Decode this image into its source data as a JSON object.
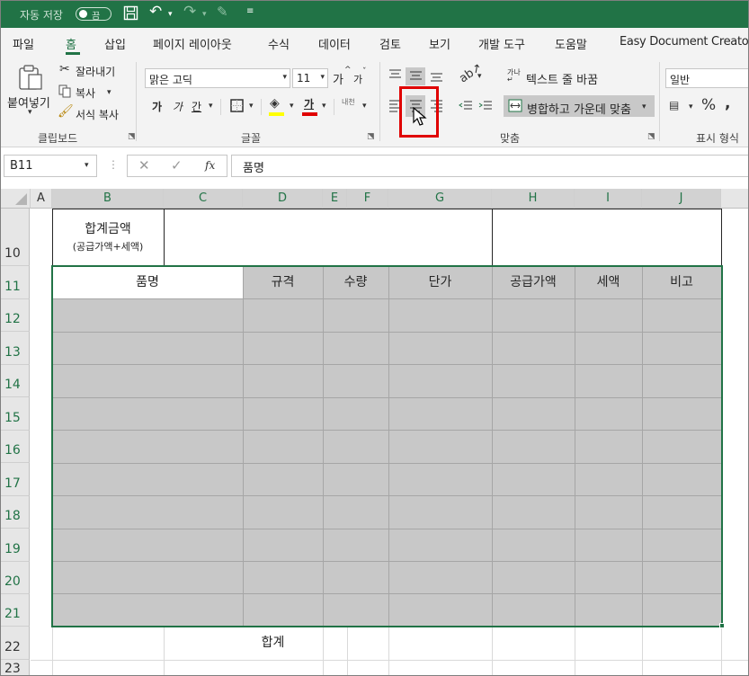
{
  "titlebar": {
    "autosave_label": "자동 저장",
    "autosave_state": "끔"
  },
  "tabs": [
    "파일",
    "홈",
    "삽입",
    "페이지 레이아웃",
    "수식",
    "데이터",
    "검토",
    "보기",
    "개발 도구",
    "도움말",
    "Easy Document Creator"
  ],
  "active_tab": "홈",
  "ribbon": {
    "clipboard": {
      "paste": "붙여넣기",
      "cut": "잘라내기",
      "copy": "복사",
      "format_painter": "서식 복사",
      "group_label": "클립보드"
    },
    "font": {
      "font_name": "맑은 고딕",
      "font_size": "11",
      "grow": "가",
      "shrink": "가",
      "bold": "가",
      "italic": "가",
      "underline": "간",
      "font_color": "가",
      "phonetic": "내천",
      "group_label": "글꼴"
    },
    "alignment": {
      "wrap_text": "텍스트 줄 바꿈",
      "merge_center": "병합하고 가운데 맞춤",
      "group_label": "맞춤"
    },
    "number": {
      "format": "일반",
      "group_label": "표시 형식"
    }
  },
  "formula_bar": {
    "name_box": "B11",
    "fx": "fx",
    "content": "품명"
  },
  "columns": [
    "A",
    "B",
    "C",
    "D",
    "E",
    "F",
    "G",
    "H",
    "I",
    "J"
  ],
  "rows": [
    "10",
    "11",
    "12",
    "13",
    "14",
    "15",
    "16",
    "17",
    "18",
    "19",
    "20",
    "21",
    "22",
    "23"
  ],
  "sheet": {
    "total_label": "합계금액",
    "total_sub": "(공급가액+세액)",
    "headers": [
      "품명",
      "규격",
      "수량",
      "단가",
      "공급가액",
      "세액",
      "비고"
    ],
    "sum_label": "합계"
  },
  "colors": {
    "accent": "#217346",
    "selection_fill": "#c8c8c8",
    "highlight_box": "#e00000"
  }
}
